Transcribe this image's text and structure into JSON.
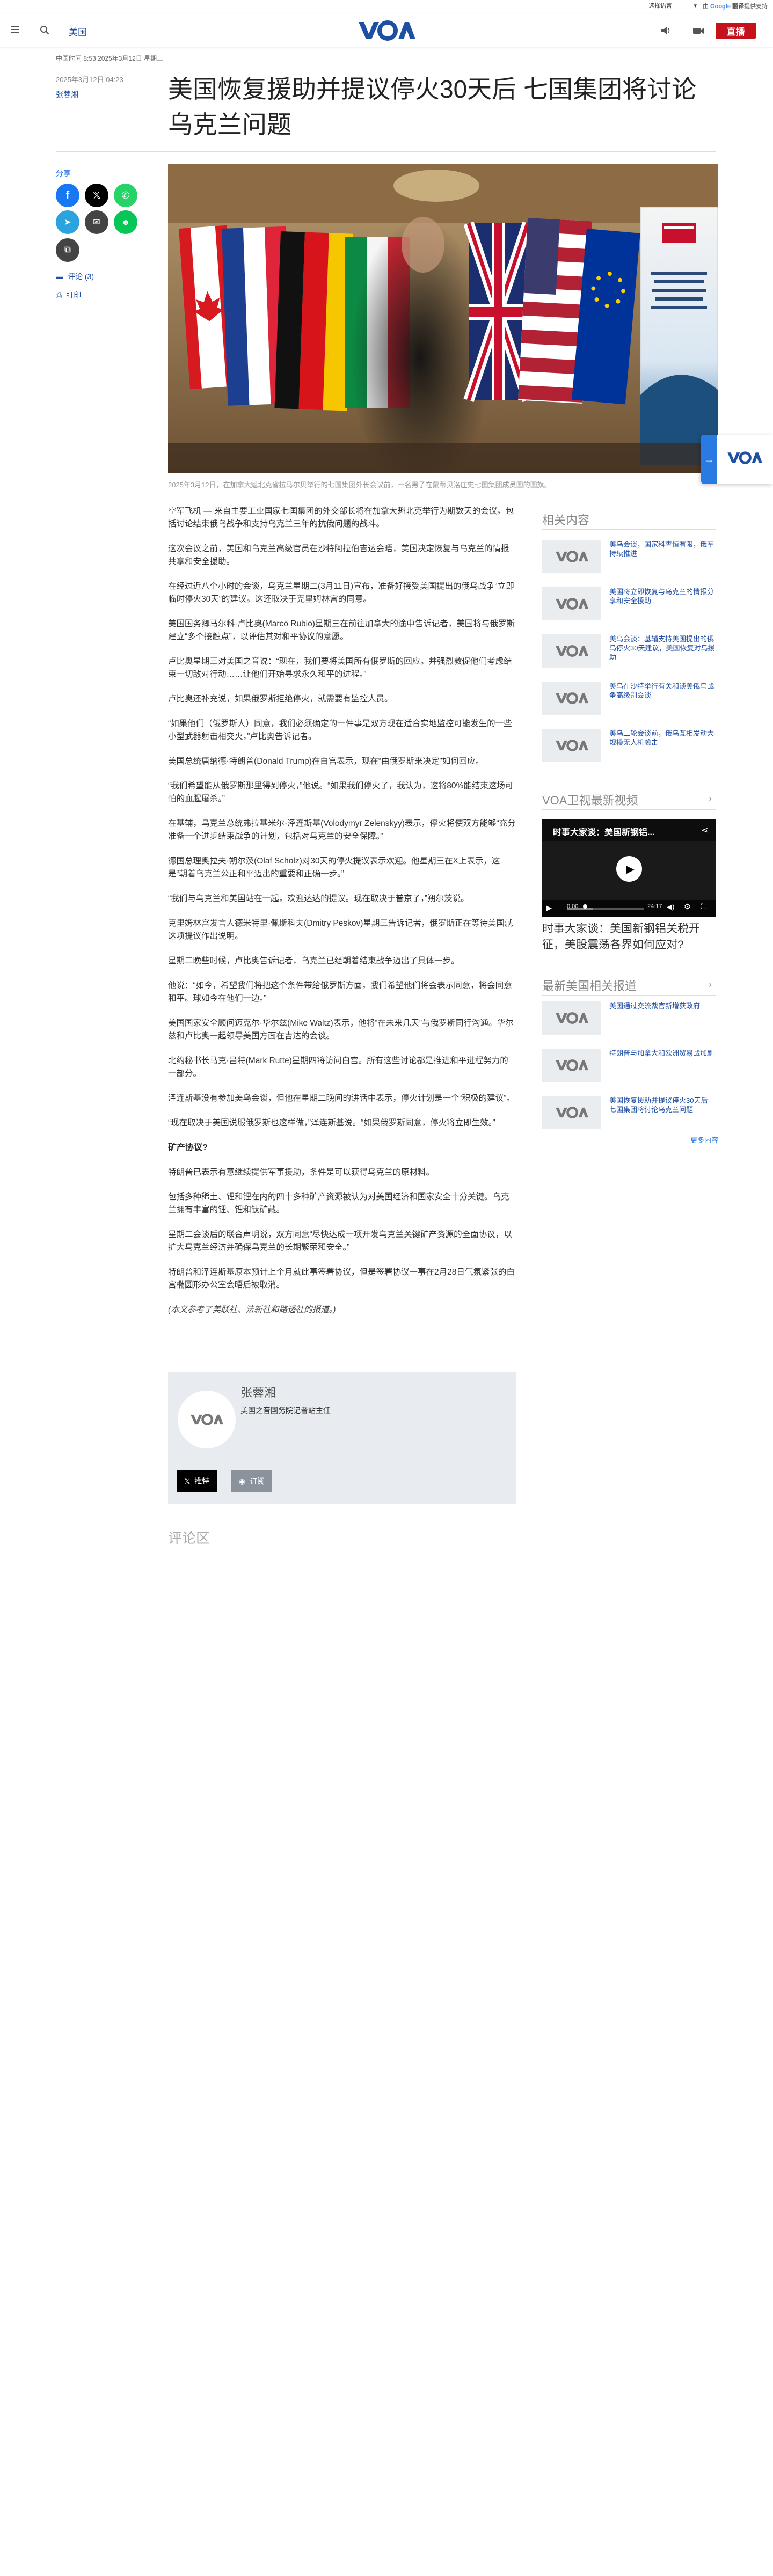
{
  "translate": {
    "select_label": "选择语言",
    "powered_by": "由",
    "google": "Google",
    "translate_word": "翻译",
    "powered_suffix": "提供支持"
  },
  "header": {
    "section": "美国",
    "logo_text": "VOA",
    "live_label": "直播"
  },
  "article": {
    "updated": "中国时间 8:53 2025年3月12日 星期三",
    "date": "2025年3月12日 04:23",
    "author": "张蓉湘",
    "title": "美国恢复援助并提议停火30天后 七国集团将讨论乌克兰问题",
    "caption": "2025年3月12日，在加拿大魁北克省拉马尔贝举行的七国集团外长会议前，一名男子在蒙蒂贝洛庄史七国集团成员国的国旗。",
    "paragraphs": [
      "空军飞机 — 来自主要工业国家七国集团的外交部长将在加拿大魁北克举行为期数天的会议。包括讨论结束俄乌战争和支持乌克兰三年的抗俄问题的战斗。",
      "这次会议之前，美国和乌克兰高级官员在沙特阿拉伯吉达会晤，美国决定恢复与乌克兰的情报共享和安全援助。",
      "在经过近八个小时的会谈，乌克兰星期二(3月11日)宣布，准备好接受美国提出的俄乌战争“立即临时停火30天”的建议。这还取决于克里姆林宫的同意。",
      "美国国务卿马尔科·卢比奥(Marco Rubio)星期三在前往加拿大的途中告诉记者，美国将与俄罗斯建立“多个接触点”，以评估其对和平协议的意愿。",
      "卢比奥星期三对美国之音说：“现在，我们要将美国所有俄罗斯的回应。并强烈敦促他们考虑结束一切敌对行动……让他们开始寻求永久和平的进程。”",
      "卢比奥还补充说，如果俄罗斯拒绝停火，就需要有监控人员。",
      "“如果他们（俄罗斯人）同意，我们必须确定的一件事是双方现在适合实地监控可能发生的一些小型武器射击相交火，”卢比奥告诉记者。",
      "美国总统唐纳德·特朗普(Donald Trump)在白宫表示，现在“由俄罗斯来决定”如何回应。",
      "“我们希望能从俄罗斯那里得到停火，”他说。“如果我们停火了，我认为，这将80%能结束这场可怕的血腥屠杀。”",
      "在基辅，乌克兰总统弗拉基米尔·泽连斯基(Volodymyr Zelenskyy)表示，停火将使双方能够“充分准备一个进步结束战争的计划，包括对乌克兰的安全保障。”",
      "德国总理奥拉夫·朔尔茨(Olaf Scholz)对30天的停火提议表示欢迎。他星期三在X上表示，这是“朝着乌克兰公正和平迈出的重要和正确一步。”",
      "“我们与乌克兰和美国站在一起，欢迎达达的提议。现在取决于普京了，”朔尔茨说。",
      "克里姆林宫发言人德米特里·佩斯科夫(Dmitry Peskov)星期三告诉记者，俄罗斯正在等待美国就这项提议作出说明。",
      "星期二晚些时候，卢比奥告诉记者，乌克兰已经朝着结束战争迈出了具体一步。",
      "他说：“如今，希望我们将把这个条件带给俄罗斯方面，我们希望他们将会表示同意，将会同意和平。球如今在他们一边。”",
      "美国国家安全顾问迈克尔·华尔兹(Mike Waltz)表示，他将“在未来几天”与俄罗斯同行沟通。华尔兹和卢比奥一起领导美国方面在吉达的会谈。",
      "北约秘书长马克·吕特(Mark Rutte)星期四将访问白宫。所有这些讨论都是推进和平进程努力的一部分。",
      "泽连斯基没有参加美乌会谈，但他在星期二晚间的讲话中表示，停火计划是一个“积极的建议”。",
      "“现在取决于美国说服俄罗斯也这样做，”泽连斯基说。“如果俄罗斯同意，停火将立即生效。”"
    ],
    "subheading": "矿产协议?",
    "paragraphs2": [
      "特朗普已表示有意继续提供军事援助，条件是可以获得乌克兰的原材料。",
      "包括多种稀土、锂和锂在内的四十多种矿产资源被认为对美国经济和国家安全十分关键。乌克兰拥有丰富的锂、锂和钛矿藏。",
      "星期二会谈后的联合声明说，双方同意“尽快达成一项开发乌克兰关键矿产资源的全面协议，以扩大乌克兰经济并确保乌克兰的长期繁荣和安全。”",
      "特朗普和泽连斯基原本预计上个月就此事签署协议，但是签署协议一事在2月28日气氛紧张的白宫椭圆形办公室会晤后被取消。"
    ],
    "note": "(本文参考了美联社、法新社和路透社的报道。)"
  },
  "author_box": {
    "name": "张蓉湘",
    "title": "美国之音国务院记者站主任",
    "follow_x": "推特",
    "follow_rss": "订阅"
  },
  "comments": {
    "title": "评论区"
  },
  "share": {
    "label": "分享",
    "comments": "评论 (3)",
    "print": "打印"
  },
  "related": {
    "title": "相关内容",
    "items": [
      "美乌会谈，国家科查恒有限，俄军持续推进",
      "美国将立即恢复与乌克兰的情报分享和安全援助",
      "美乌会谈：基辅支持美国提出的俄乌停火30天建议，美国恢复对乌援助",
      "美乌在沙特举行有关和谈美俄乌战争高级别会谈",
      "美乌二轮会谈前，俄乌互相发动大规模无人机袭击"
    ]
  },
  "video": {
    "section_title": "VOA卫视最新视频",
    "overlay_title": "时事大家谈：美国新钢铝...",
    "time_current": "0:00",
    "time_total": "24:17",
    "title": "时事大家谈：美国新钢铝关税开征，美股震荡各界如何应对?"
  },
  "latest": {
    "title": "最新美国相关报道",
    "items": [
      "美国通过交流裁官新增获政府",
      "特朗普与加拿大和欧洲贸易战加剧",
      "美国恢复援助并提议停火30天后 七国集团将讨论乌克兰问题"
    ],
    "more": "更多内容"
  },
  "colors": {
    "brand_blue": "#1f4ea5",
    "accent_blue": "#2a7ae4",
    "live_red": "#c4111b"
  }
}
